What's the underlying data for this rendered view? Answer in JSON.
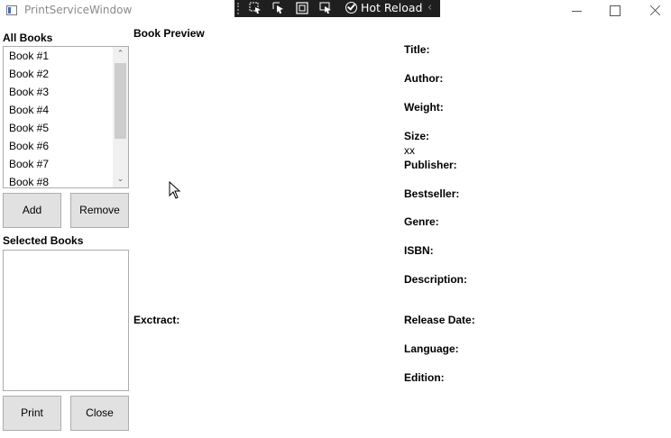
{
  "window": {
    "title": "PrintServiceWindow"
  },
  "debug_toolbar": {
    "hot_reload_label": "Hot Reload",
    "icons": [
      "select-element-icon",
      "pointer-icon",
      "display-layout-adorners-icon",
      "track-focused-element-icon",
      "hot-reload-check-icon",
      "collapse-chevron-icon"
    ]
  },
  "all_books": {
    "heading": "All Books",
    "items": [
      "Book #1",
      "Book #2",
      "Book #3",
      "Book #4",
      "Book #5",
      "Book #6",
      "Book #7",
      "Book #8"
    ],
    "add_label": "Add",
    "remove_label": "Remove"
  },
  "selected_books": {
    "heading": "Selected Books",
    "items": [],
    "print_label": "Print",
    "close_label": "Close"
  },
  "preview": {
    "heading": "Book Preview",
    "extract_label": "Exctract:"
  },
  "details": {
    "title_label": "Title:",
    "author_label": "Author:",
    "weight_label": "Weight:",
    "size_label": "Size:",
    "size_value": "xx",
    "publisher_label": "Publisher:",
    "bestseller_label": "Bestseller:",
    "genre_label": "Genre:",
    "isbn_label": "ISBN:",
    "description_label": "Description:",
    "release_date_label": "Release Date:",
    "language_label": "Language:",
    "edition_label": "Edition:"
  }
}
